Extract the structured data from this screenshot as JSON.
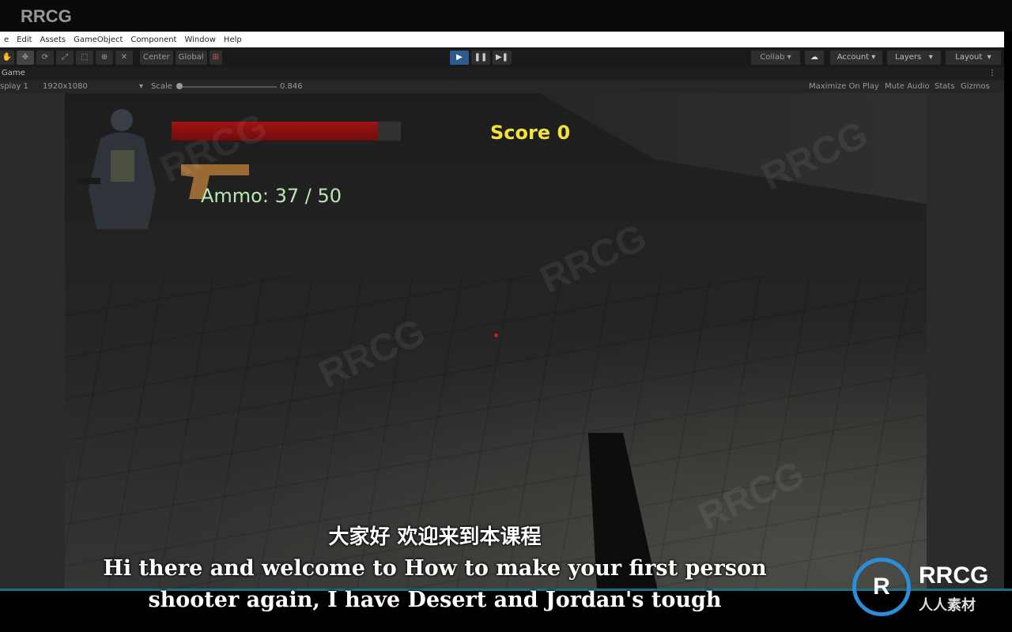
{
  "watermark": {
    "top": "RRCG",
    "brand": "RRCG",
    "brand_cn": "人人素材"
  },
  "menu": [
    "e",
    "Edit",
    "Assets",
    "GameObject",
    "Component",
    "Window",
    "Help"
  ],
  "toolbar": {
    "pivot": "Center",
    "space": "Global",
    "play_state": "playing",
    "collab": "Collab",
    "account": "Account",
    "layers": "Layers",
    "layout": "Layout"
  },
  "tab": {
    "title": "Game"
  },
  "gamebar": {
    "display": "splay 1",
    "resolution": "1920x1080",
    "scale_label": "Scale",
    "scale_value": "0.846",
    "maximize": "Maximize On Play",
    "mute": "Mute Audio",
    "stats": "Stats",
    "gizmos": "Gizmos"
  },
  "hud": {
    "health_fraction": 0.9,
    "health_color": "#a01414",
    "score": "Score 0",
    "ammo": "Ammo: 37 / 50",
    "score_color": "#f2e23a"
  },
  "subtitles": {
    "cn": "大家好 欢迎来到本课程",
    "en1": "Hi there and welcome to How to make your first person",
    "en2": "shooter again, I have Desert and Jordan's tough"
  }
}
